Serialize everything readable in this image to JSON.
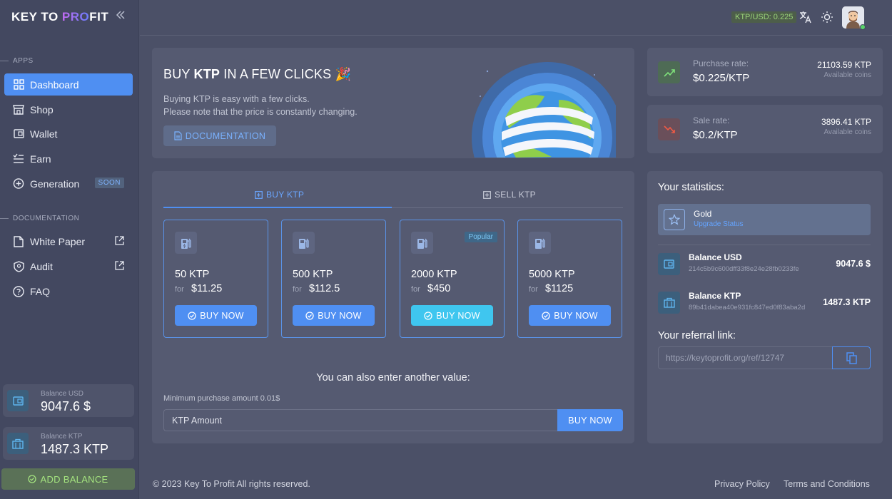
{
  "brand": {
    "part1": "KEY TO ",
    "part2": "PRO",
    "part3": "FIT"
  },
  "sidebar": {
    "apps_label": "APPS",
    "items": [
      {
        "label": "Dashboard"
      },
      {
        "label": "Shop"
      },
      {
        "label": "Wallet"
      },
      {
        "label": "Earn"
      },
      {
        "label": "Generation",
        "badge": "SOON"
      }
    ],
    "docs_label": "DOCUMENTATION",
    "doc_items": [
      {
        "label": "White Paper"
      },
      {
        "label": "Audit"
      },
      {
        "label": "FAQ"
      }
    ],
    "balance_usd": {
      "label": "Balance USD",
      "value": "9047.6 $"
    },
    "balance_ktp": {
      "label": "Balance KTP",
      "value": "1487.3 KTP"
    },
    "add_balance": "ADD BALANCE"
  },
  "topbar": {
    "rate": "KTP/USD: 0.225"
  },
  "hero": {
    "title_pre": "BUY ",
    "title_bold": "KTP",
    "title_post": " IN A FEW CLICKS 🎉",
    "line1": "Buying KTP is easy with a few clicks.",
    "line2": "Please note that the price is constantly changing.",
    "doc_button": "DOCUMENTATION"
  },
  "rates": {
    "purchase": {
      "label": "Purchase rate:",
      "value": "$0.225/KTP",
      "amount": "21103.59 KTP",
      "sub": "Available coins"
    },
    "sale": {
      "label": "Sale rate:",
      "value": "$0.2/KTP",
      "amount": "3896.41 KTP",
      "sub": "Available coins"
    }
  },
  "trade": {
    "tab_buy": "BUY KTP",
    "tab_sell": "SELL KTP",
    "packages": [
      {
        "amount": "50 KTP",
        "for": "for",
        "price": "$11.25",
        "button": "BUY NOW"
      },
      {
        "amount": "500 KTP",
        "for": "for",
        "price": "$112.5",
        "button": "BUY NOW"
      },
      {
        "amount": "2000 KTP",
        "for": "for",
        "price": "$450",
        "button": "BUY NOW",
        "badge": "Popular"
      },
      {
        "amount": "5000 KTP",
        "for": "for",
        "price": "$1125",
        "button": "BUY NOW"
      }
    ],
    "another": "You can also enter another value:",
    "minimum": "Minimum purchase amount 0.01$",
    "input_placeholder": "KTP Amount",
    "buy_button": "BUY NOW"
  },
  "stats": {
    "title": "Your statistics:",
    "status_name": "Gold",
    "status_link": "Upgrade Status",
    "balance_usd": {
      "name": "Balance USD",
      "hash": "214c5b9c600dff33f8e24e28fb0233fe",
      "value": "9047.6 $"
    },
    "balance_ktp": {
      "name": "Balance KTP",
      "hash": "89b41dabea40e931fc847ed0f83aba2d",
      "value": "1487.3 KTP"
    },
    "referral_title": "Your referral link:",
    "referral_value": "https://keytoprofit.org/ref/12747"
  },
  "footer": {
    "copyright": "© 2023 Key To Profit All rights reserved.",
    "privacy": "Privacy Policy",
    "terms": "Terms and Conditions"
  },
  "colors": {
    "accent": "#4f8ff2",
    "popular": "#3fc6ef",
    "green": "#9bd47a",
    "red": "#e0533f"
  }
}
